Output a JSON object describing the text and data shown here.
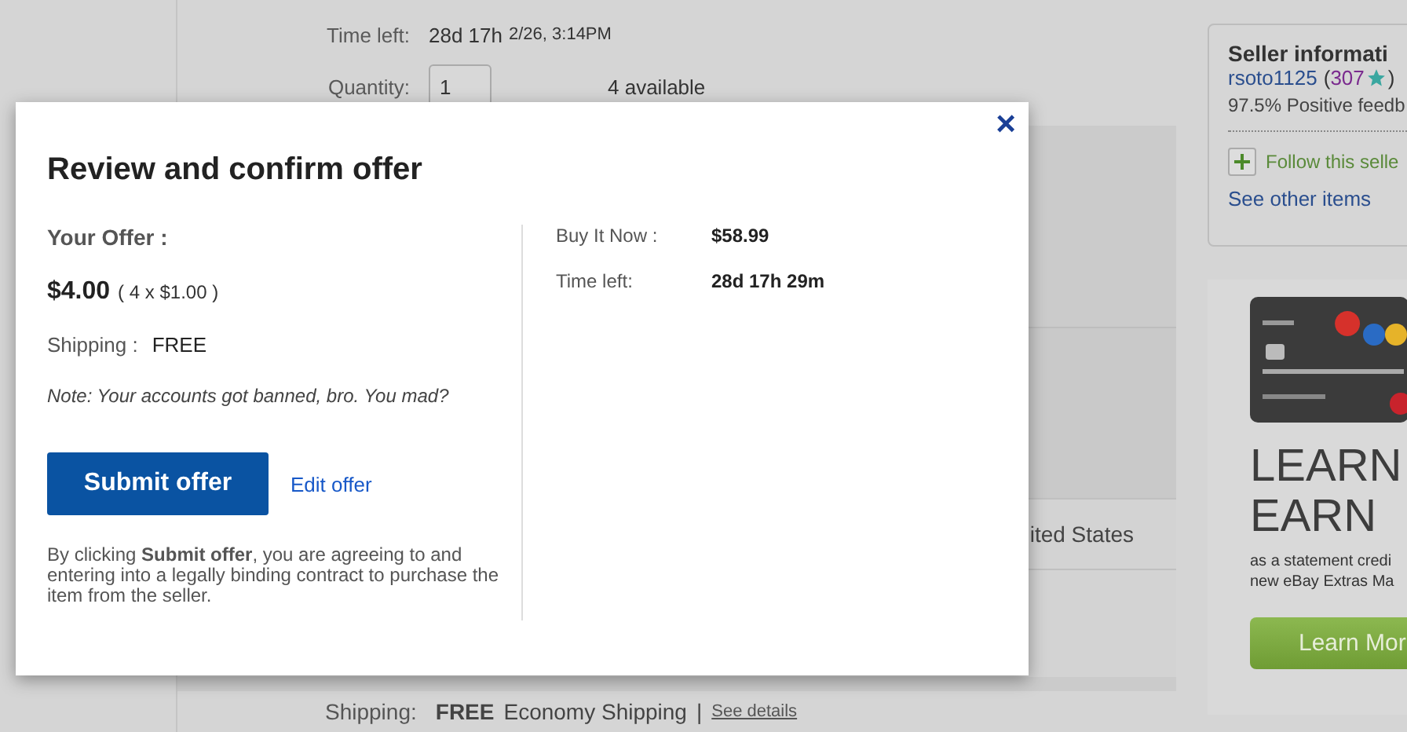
{
  "item_details": {
    "time_left": {
      "label": "Time left:",
      "value": "28d 17h",
      "detail": "2/26, 3:14PM"
    },
    "quantity": {
      "label": "Quantity:",
      "value": "1",
      "available": "4 available"
    },
    "ship_to_fragment": "ited States"
  },
  "shipping_row": {
    "label": "Shipping:",
    "value": "FREE",
    "service": "Economy Shipping",
    "separator": "|",
    "link": "See details"
  },
  "seller": {
    "title": "Seller informati",
    "name": "rsoto1125",
    "open_paren": "(",
    "score": "307",
    "close_paren": ")",
    "feedback": "97.5% Positive feedb",
    "follow": "Follow this selle",
    "other_items": "See other items"
  },
  "ad": {
    "headline": [
      "LEARN",
      "EARN"
    ],
    "lines": [
      "as a statement credi",
      "new eBay Extras Ma"
    ],
    "button": "Learn Mor"
  },
  "dialog": {
    "close": "×",
    "title": "Review and confirm offer",
    "offer_label": "Your Offer :",
    "offer_total": "$4.00",
    "offer_breakdown": "( 4 x $1.00 )",
    "shipping_label": "Shipping :",
    "shipping_value": "FREE",
    "note": "Note: Your accounts got banned, bro. You mad?",
    "submit": "Submit offer",
    "edit": "Edit offer",
    "disclaimer": "By clicking **Submit offer**, you are agreeing to and entering into a legally binding contract to purchase the item from the seller.",
    "facts": [
      {
        "label": "Buy It Now :",
        "value": "$58.99"
      },
      {
        "label": "Time left:",
        "value": "28d 17h 29m"
      }
    ]
  }
}
